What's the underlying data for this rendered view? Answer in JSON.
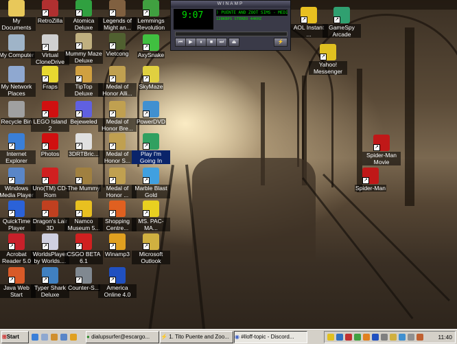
{
  "desktop": {
    "icons": [
      {
        "label": "My Documents",
        "icon": "folder-documents-icon",
        "color": "#e8c85a"
      },
      {
        "label": "My Computer",
        "icon": "computer-icon",
        "color": "#9fb4c8"
      },
      {
        "label": "My Network Places",
        "icon": "network-icon",
        "color": "#8fa8d0"
      },
      {
        "label": "Recycle Bin",
        "icon": "recycle-bin-icon",
        "color": "#a0a0a0"
      },
      {
        "label": "Internet Explorer",
        "icon": "internet-explorer-icon",
        "color": "#3a7fd8"
      },
      {
        "label": "Windows Media Player",
        "icon": "media-player-icon",
        "color": "#5a86c8"
      },
      {
        "label": "QuickTime Player",
        "icon": "quicktime-icon",
        "color": "#2b62d8"
      },
      {
        "label": "Acrobat Reader 5.0",
        "icon": "acrobat-icon",
        "color": "#c8202a"
      },
      {
        "label": "Java Web Start",
        "icon": "java-icon",
        "color": "#d85a28"
      },
      {
        "label": "RetroZilla",
        "icon": "retrozilla-icon",
        "color": "#b03030"
      },
      {
        "label": "Virtual CloneDrive",
        "icon": "clonedrive-icon",
        "color": "#d0d0d0"
      },
      {
        "label": "Fraps",
        "icon": "fraps-icon",
        "color": "#e8d830"
      },
      {
        "label": "LEGO Island 2",
        "icon": "lego-icon",
        "color": "#d01010"
      },
      {
        "label": "Photos",
        "icon": "lego-photos-icon",
        "color": "#d01010"
      },
      {
        "label": "Uno(TM) CD-Rom",
        "icon": "uno-icon",
        "color": "#d02020"
      },
      {
        "label": "Dragon's Lair 3D",
        "icon": "dragons-lair-icon",
        "color": "#c04020"
      },
      {
        "label": "WorldsPlayer by Worlds....",
        "icon": "worlds-icon",
        "color": "#d0d0e0"
      },
      {
        "label": "Typer Shark Deluxe",
        "icon": "typer-shark-icon",
        "color": "#4080c0"
      },
      {
        "label": "Atomica Deluxe",
        "icon": "atomica-icon",
        "color": "#30a040"
      },
      {
        "label": "Mummy Maze Deluxe",
        "icon": "mummy-maze-icon",
        "color": "#c0b080"
      },
      {
        "label": "TipTop Deluxe",
        "icon": "tiptop-icon",
        "color": "#d0a040"
      },
      {
        "label": "Bejeweled",
        "icon": "bejeweled-icon",
        "color": "#6060e0"
      },
      {
        "label": "3DRTBric...",
        "icon": "bric-icon",
        "color": "#e0e0e0"
      },
      {
        "label": "The Mummy",
        "icon": "the-mummy-icon",
        "color": "#a08040"
      },
      {
        "label": "Namco Museum 5...",
        "icon": "namco-museum-icon",
        "color": "#e8c020"
      },
      {
        "label": "CSGO BETA 6.1",
        "icon": "csgo-icon",
        "color": "#d02020"
      },
      {
        "label": "Counter-S...",
        "icon": "counter-strike-icon",
        "color": "#808890"
      },
      {
        "label": "Legends of Might an...",
        "icon": "legends-icon",
        "color": "#806040"
      },
      {
        "label": "Vietcong",
        "icon": "vietcong-icon",
        "color": "#506030"
      },
      {
        "label": "Medal of Honor Alli...",
        "icon": "medal-of-honor-icon",
        "color": "#c0a050"
      },
      {
        "label": "Medal of Honor Bre...",
        "icon": "medal-of-honor-icon",
        "color": "#c0a050"
      },
      {
        "label": "Medal of Honor S...",
        "icon": "medal-of-honor-icon",
        "color": "#c0a050"
      },
      {
        "label": "Medal of Honor ...",
        "icon": "medal-of-honor-icon",
        "color": "#c0a050"
      },
      {
        "label": "Shopping Centre...",
        "icon": "shopping-icon",
        "color": "#e06020"
      },
      {
        "label": "Winamp3",
        "icon": "winamp-icon",
        "color": "#e0a020"
      },
      {
        "label": "America Online 4.0",
        "icon": "aol-icon",
        "color": "#2050c0"
      },
      {
        "label": "Lemmings Revolution",
        "icon": "lemmings-icon",
        "color": "#40a040"
      },
      {
        "label": "AxySnake",
        "icon": "axysnake-icon",
        "color": "#40c040"
      },
      {
        "label": "SkyMaze",
        "icon": "skymaze-icon",
        "color": "#e0d040"
      },
      {
        "label": "PowerDVD",
        "icon": "powerdvd-icon",
        "color": "#4090d0"
      },
      {
        "label": "Play I'm Going In",
        "icon": "play-icon",
        "color": "#30a060"
      },
      {
        "label": "Marble Blast Gold",
        "icon": "marble-blast-icon",
        "color": "#40a0e0"
      },
      {
        "label": "MS. PAC-MA...",
        "icon": "pacman-icon",
        "color": "#e8d020"
      },
      {
        "label": "Microsoft Outlook",
        "icon": "outlook-icon",
        "color": "#d0b040"
      },
      {
        "label": "AOL Instant ...",
        "icon": "aim-icon",
        "color": "#e8c020"
      },
      {
        "label": "GameSpy Arcade",
        "icon": "gamespy-icon",
        "color": "#30a070"
      },
      {
        "label": "Yahoo! Messenger",
        "icon": "yahoo-messenger-icon",
        "color": "#e0c020"
      },
      {
        "label": "Spider-Man Movie",
        "icon": "spiderman-icon",
        "color": "#c01818"
      },
      {
        "label": "Spider-Man",
        "icon": "spiderman-icon",
        "color": "#c01818"
      }
    ]
  },
  "winamp": {
    "title": "WINAMP",
    "time": "9:07",
    "marquee": ") PUENTE AND ZOOT SIMS - MEDITA",
    "kbps": "128",
    "khz": "44",
    "mode": "STEREO"
  },
  "taskbar": {
    "start_label": "Start",
    "buttons": [
      {
        "label": "dialupsurfer@escargo...",
        "icon": "messenger-icon"
      },
      {
        "label": "1. Tito Puente and Zoo...",
        "icon": "winamp-icon"
      },
      {
        "label": "#lloff-topic - Discord...",
        "icon": "browser-icon"
      }
    ],
    "clock": "11:40"
  }
}
